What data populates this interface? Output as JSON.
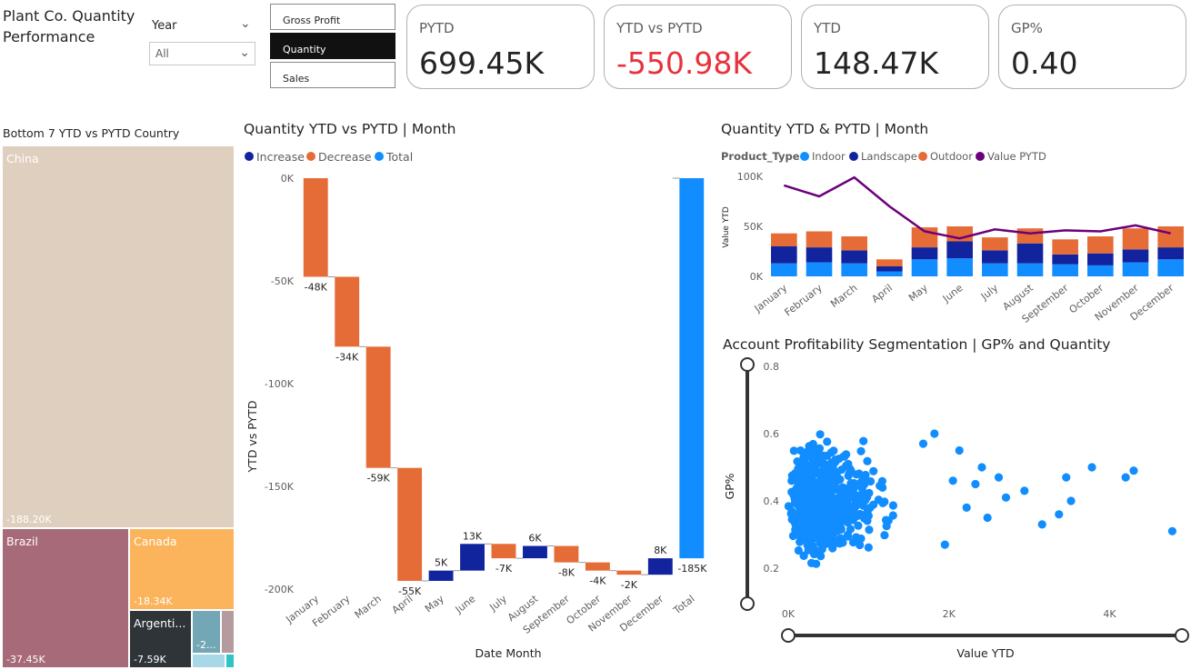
{
  "header": {
    "title": "Plant Co. Quantity Performance",
    "slicer_label": "Year",
    "slicer_value": "All",
    "measure_buttons": [
      {
        "label": "Gross Profit",
        "active": false
      },
      {
        "label": "Quantity",
        "active": true
      },
      {
        "label": "Sales",
        "active": false
      }
    ]
  },
  "kpis": [
    {
      "label": "PYTD",
      "value": "699.45K",
      "negative": false
    },
    {
      "label": "YTD vs PYTD",
      "value": "-550.98K",
      "negative": true
    },
    {
      "label": "YTD",
      "value": "148.47K",
      "negative": false
    },
    {
      "label": "GP%",
      "value": "0.40",
      "negative": false
    }
  ],
  "treemap": {
    "title": "Bottom 7 YTD vs PYTD Country",
    "tiles": [
      {
        "name": "China",
        "value": "-188.20K",
        "color": "#dfcfbe"
      },
      {
        "name": "Brazil",
        "value": "-37.45K",
        "color": "#a66a79"
      },
      {
        "name": "Canada",
        "value": "-18.34K",
        "color": "#fbb45c"
      },
      {
        "name": "Argenti...",
        "value": "-7.59K",
        "color": "#2e3438"
      },
      {
        "name": "",
        "value": "-2...",
        "color": "#73a7b5"
      },
      {
        "name": "",
        "value": "",
        "color": "#b59a9e"
      },
      {
        "name": "",
        "value": "",
        "color": "#a8d8e8"
      },
      {
        "name": "",
        "value": "",
        "color": "#2ec4c6"
      }
    ]
  },
  "chart_data": [
    {
      "type": "waterfall",
      "title": "Quantity YTD vs PYTD | Month",
      "legend": [
        "Increase",
        "Decrease",
        "Total"
      ],
      "colors": {
        "Increase": "#12239e",
        "Decrease": "#e66c37",
        "Total": "#118dff"
      },
      "xlabel": "Date Month",
      "ylabel": "YTD vs PYTD",
      "ylim": [
        -200000,
        0
      ],
      "yticks": [
        0,
        -50000,
        -100000,
        -150000,
        -200000
      ],
      "ytick_labels": [
        "0K",
        "-50K",
        "-100K",
        "-150K",
        "-200K"
      ],
      "categories": [
        "January",
        "February",
        "March",
        "April",
        "May",
        "June",
        "July",
        "August",
        "September",
        "October",
        "November",
        "December",
        "Total"
      ],
      "values": [
        -48000,
        -34000,
        -59000,
        -55000,
        5000,
        13000,
        -7000,
        6000,
        -8000,
        -4000,
        -2000,
        8000,
        -185000
      ],
      "labels": [
        "-48K",
        "-34K",
        "-59K",
        "-55K",
        "5K",
        "13K",
        "-7K",
        "6K",
        "-8K",
        "-4K",
        "-2K",
        "8K",
        "-185K"
      ]
    },
    {
      "type": "stacked-bar-line",
      "title": "Quantity YTD & PYTD | Month",
      "legend_title": "Product_Type",
      "legend": [
        "Indoor",
        "Landscape",
        "Outdoor",
        "Value PYTD"
      ],
      "colors": {
        "Indoor": "#118dff",
        "Landscape": "#12239e",
        "Outdoor": "#e66c37",
        "Value PYTD": "#6b007b"
      },
      "ylabel": "Value YTD",
      "ylim": [
        0,
        100000
      ],
      "yticks": [
        0,
        50000,
        100000
      ],
      "ytick_labels": [
        "0K",
        "50K",
        "100K"
      ],
      "categories": [
        "January",
        "February",
        "March",
        "April",
        "May",
        "June",
        "July",
        "August",
        "September",
        "October",
        "November",
        "December"
      ],
      "series": [
        {
          "name": "Indoor",
          "values": [
            13000,
            14000,
            13000,
            5000,
            17000,
            18000,
            13000,
            13000,
            12000,
            11000,
            14000,
            17000
          ]
        },
        {
          "name": "Landscape",
          "values": [
            17000,
            15000,
            13000,
            5000,
            12000,
            17000,
            13000,
            20000,
            10000,
            12000,
            13000,
            12000
          ]
        },
        {
          "name": "Outdoor",
          "values": [
            13000,
            16000,
            14000,
            7000,
            20000,
            15000,
            13000,
            15000,
            15000,
            17000,
            21000,
            21000
          ]
        },
        {
          "name": "Value PYTD",
          "values": [
            91000,
            80000,
            99000,
            70000,
            45000,
            38000,
            47000,
            43000,
            46000,
            45000,
            51000,
            43000
          ]
        }
      ]
    },
    {
      "type": "scatter",
      "title": "Account Profitability Segmentation | GP% and Quantity",
      "xlabel": "Value YTD",
      "ylabel": "GP%",
      "xlim": [
        0,
        4900
      ],
      "ylim": [
        0.1,
        0.8
      ],
      "xticks": [
        0,
        2000,
        4000
      ],
      "xtick_labels": [
        "0K",
        "2K",
        "4K"
      ],
      "yticks": [
        0.2,
        0.4,
        0.6,
        0.8
      ],
      "ytick_labels": [
        "0.2",
        "0.4",
        "0.6",
        "0.8"
      ],
      "color": "#118dff",
      "outliers": [
        [
          4780,
          0.31
        ],
        [
          4300,
          0.49
        ],
        [
          4200,
          0.47
        ],
        [
          3780,
          0.5
        ],
        [
          3460,
          0.47
        ],
        [
          3520,
          0.4
        ],
        [
          3370,
          0.36
        ],
        [
          3160,
          0.33
        ],
        [
          2940,
          0.43
        ],
        [
          2710,
          0.41
        ],
        [
          2620,
          0.47
        ],
        [
          2410,
          0.5
        ],
        [
          2130,
          0.55
        ],
        [
          2220,
          0.38
        ],
        [
          1950,
          0.27
        ],
        [
          2050,
          0.46
        ],
        [
          2330,
          0.45
        ],
        [
          1680,
          0.57
        ],
        [
          1820,
          0.6
        ],
        [
          2480,
          0.35
        ]
      ]
    }
  ]
}
